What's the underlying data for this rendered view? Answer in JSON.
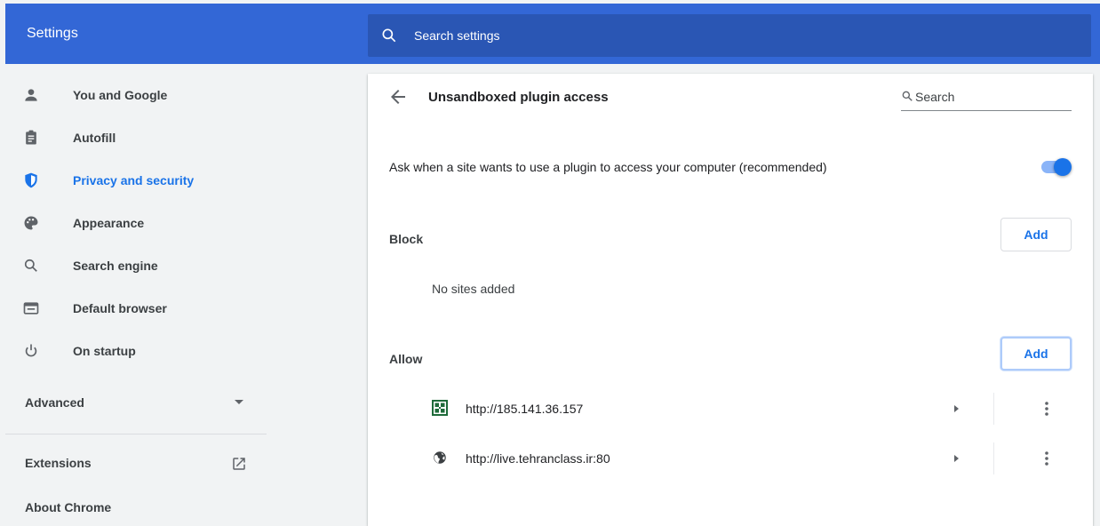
{
  "header": {
    "app_title": "Settings",
    "search_placeholder": "Search settings"
  },
  "sidebar": {
    "items": [
      {
        "label": "You and Google",
        "icon": "person-icon"
      },
      {
        "label": "Autofill",
        "icon": "clipboard-icon"
      },
      {
        "label": "Privacy and security",
        "icon": "shield-icon",
        "active": true
      },
      {
        "label": "Appearance",
        "icon": "palette-icon"
      },
      {
        "label": "Search engine",
        "icon": "search-icon"
      },
      {
        "label": "Default browser",
        "icon": "browser-window-icon"
      },
      {
        "label": "On startup",
        "icon": "power-icon"
      }
    ],
    "advanced_label": "Advanced",
    "extensions_label": "Extensions",
    "about_label": "About Chrome"
  },
  "main": {
    "title": "Unsandboxed plugin access",
    "search_placeholder": "Search",
    "ask_text": "Ask when a site wants to use a plugin to access your computer (recommended)",
    "ask_enabled": true,
    "block": {
      "heading": "Block",
      "add_label": "Add",
      "empty_text": "No sites added"
    },
    "allow": {
      "heading": "Allow",
      "add_label": "Add",
      "sites": [
        {
          "url": "http://185.141.36.157",
          "icon": "site-favicon"
        },
        {
          "url": "http://live.tehranclass.ir:80",
          "icon": "globe-icon"
        }
      ]
    }
  },
  "colors": {
    "header_blue": "#3367d6",
    "search_blue": "#2a56b4",
    "accent": "#1a73e8"
  }
}
